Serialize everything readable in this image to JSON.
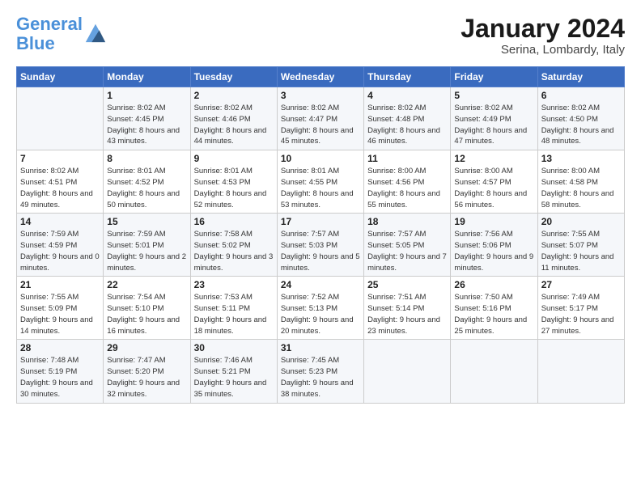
{
  "logo": {
    "line1": "General",
    "line2": "Blue"
  },
  "header": {
    "month_year": "January 2024",
    "location": "Serina, Lombardy, Italy"
  },
  "days_of_week": [
    "Sunday",
    "Monday",
    "Tuesday",
    "Wednesday",
    "Thursday",
    "Friday",
    "Saturday"
  ],
  "weeks": [
    [
      {
        "num": "",
        "info": ""
      },
      {
        "num": "1",
        "info": "Sunrise: 8:02 AM\nSunset: 4:45 PM\nDaylight: 8 hours\nand 43 minutes."
      },
      {
        "num": "2",
        "info": "Sunrise: 8:02 AM\nSunset: 4:46 PM\nDaylight: 8 hours\nand 44 minutes."
      },
      {
        "num": "3",
        "info": "Sunrise: 8:02 AM\nSunset: 4:47 PM\nDaylight: 8 hours\nand 45 minutes."
      },
      {
        "num": "4",
        "info": "Sunrise: 8:02 AM\nSunset: 4:48 PM\nDaylight: 8 hours\nand 46 minutes."
      },
      {
        "num": "5",
        "info": "Sunrise: 8:02 AM\nSunset: 4:49 PM\nDaylight: 8 hours\nand 47 minutes."
      },
      {
        "num": "6",
        "info": "Sunrise: 8:02 AM\nSunset: 4:50 PM\nDaylight: 8 hours\nand 48 minutes."
      }
    ],
    [
      {
        "num": "7",
        "info": "Sunrise: 8:02 AM\nSunset: 4:51 PM\nDaylight: 8 hours\nand 49 minutes."
      },
      {
        "num": "8",
        "info": "Sunrise: 8:01 AM\nSunset: 4:52 PM\nDaylight: 8 hours\nand 50 minutes."
      },
      {
        "num": "9",
        "info": "Sunrise: 8:01 AM\nSunset: 4:53 PM\nDaylight: 8 hours\nand 52 minutes."
      },
      {
        "num": "10",
        "info": "Sunrise: 8:01 AM\nSunset: 4:55 PM\nDaylight: 8 hours\nand 53 minutes."
      },
      {
        "num": "11",
        "info": "Sunrise: 8:00 AM\nSunset: 4:56 PM\nDaylight: 8 hours\nand 55 minutes."
      },
      {
        "num": "12",
        "info": "Sunrise: 8:00 AM\nSunset: 4:57 PM\nDaylight: 8 hours\nand 56 minutes."
      },
      {
        "num": "13",
        "info": "Sunrise: 8:00 AM\nSunset: 4:58 PM\nDaylight: 8 hours\nand 58 minutes."
      }
    ],
    [
      {
        "num": "14",
        "info": "Sunrise: 7:59 AM\nSunset: 4:59 PM\nDaylight: 9 hours\nand 0 minutes."
      },
      {
        "num": "15",
        "info": "Sunrise: 7:59 AM\nSunset: 5:01 PM\nDaylight: 9 hours\nand 2 minutes."
      },
      {
        "num": "16",
        "info": "Sunrise: 7:58 AM\nSunset: 5:02 PM\nDaylight: 9 hours\nand 3 minutes."
      },
      {
        "num": "17",
        "info": "Sunrise: 7:57 AM\nSunset: 5:03 PM\nDaylight: 9 hours\nand 5 minutes."
      },
      {
        "num": "18",
        "info": "Sunrise: 7:57 AM\nSunset: 5:05 PM\nDaylight: 9 hours\nand 7 minutes."
      },
      {
        "num": "19",
        "info": "Sunrise: 7:56 AM\nSunset: 5:06 PM\nDaylight: 9 hours\nand 9 minutes."
      },
      {
        "num": "20",
        "info": "Sunrise: 7:55 AM\nSunset: 5:07 PM\nDaylight: 9 hours\nand 11 minutes."
      }
    ],
    [
      {
        "num": "21",
        "info": "Sunrise: 7:55 AM\nSunset: 5:09 PM\nDaylight: 9 hours\nand 14 minutes."
      },
      {
        "num": "22",
        "info": "Sunrise: 7:54 AM\nSunset: 5:10 PM\nDaylight: 9 hours\nand 16 minutes."
      },
      {
        "num": "23",
        "info": "Sunrise: 7:53 AM\nSunset: 5:11 PM\nDaylight: 9 hours\nand 18 minutes."
      },
      {
        "num": "24",
        "info": "Sunrise: 7:52 AM\nSunset: 5:13 PM\nDaylight: 9 hours\nand 20 minutes."
      },
      {
        "num": "25",
        "info": "Sunrise: 7:51 AM\nSunset: 5:14 PM\nDaylight: 9 hours\nand 23 minutes."
      },
      {
        "num": "26",
        "info": "Sunrise: 7:50 AM\nSunset: 5:16 PM\nDaylight: 9 hours\nand 25 minutes."
      },
      {
        "num": "27",
        "info": "Sunrise: 7:49 AM\nSunset: 5:17 PM\nDaylight: 9 hours\nand 27 minutes."
      }
    ],
    [
      {
        "num": "28",
        "info": "Sunrise: 7:48 AM\nSunset: 5:19 PM\nDaylight: 9 hours\nand 30 minutes."
      },
      {
        "num": "29",
        "info": "Sunrise: 7:47 AM\nSunset: 5:20 PM\nDaylight: 9 hours\nand 32 minutes."
      },
      {
        "num": "30",
        "info": "Sunrise: 7:46 AM\nSunset: 5:21 PM\nDaylight: 9 hours\nand 35 minutes."
      },
      {
        "num": "31",
        "info": "Sunrise: 7:45 AM\nSunset: 5:23 PM\nDaylight: 9 hours\nand 38 minutes."
      },
      {
        "num": "",
        "info": ""
      },
      {
        "num": "",
        "info": ""
      },
      {
        "num": "",
        "info": ""
      }
    ]
  ]
}
